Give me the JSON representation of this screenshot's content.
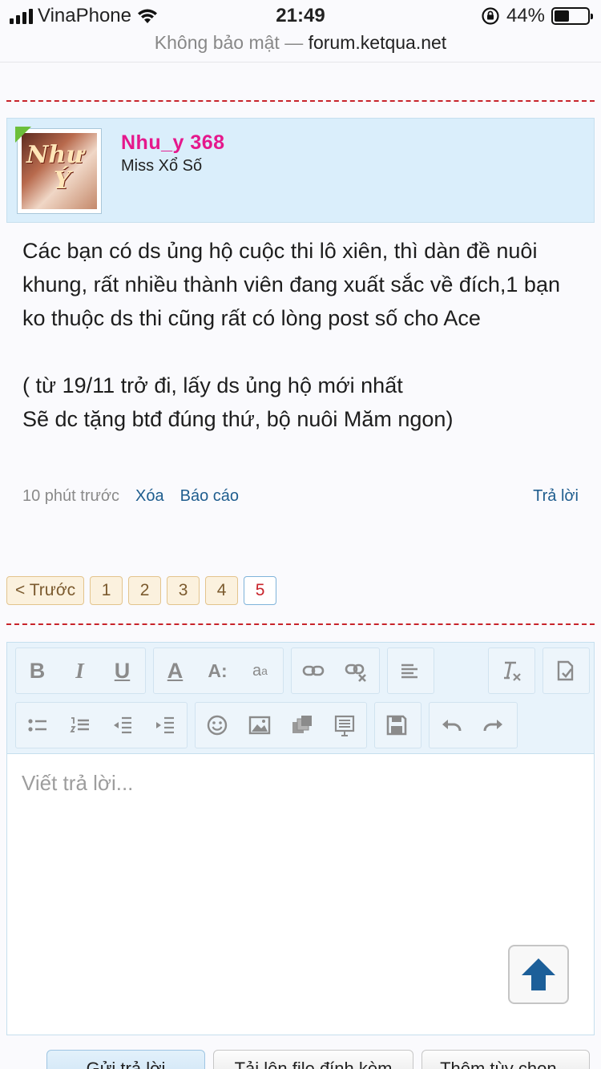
{
  "status_bar": {
    "carrier": "VinaPhone",
    "time": "21:49",
    "battery": "44%",
    "battery_level": 0.44
  },
  "url_bar": {
    "security": "Không bảo mật —",
    "domain": "forum.ketqua.net"
  },
  "post": {
    "author": "Nhu_y 368",
    "author_title": "Miss Xổ Số",
    "avatar_text_1": "Như",
    "avatar_text_2": "Ý",
    "body_1": "Các bạn có ds ủng hộ cuộc thi lô xiên, thì dàn đề nuôi khung, rất nhiều thành viên đang xuất sắc về đích,1 bạn ko thuộc ds thi cũng rất có lòng post số cho Ace",
    "body_2": "( từ 19/11 trở đi, lấy ds ủng hộ mới nhất\nSẽ dc tặng btđ đúng thứ, bộ nuôi Măm ngon)",
    "time": "10 phút trước",
    "delete": "Xóa",
    "report": "Báo cáo",
    "reply": "Trả lời"
  },
  "pagination": {
    "prev": "< Trước",
    "pages": [
      "1",
      "2",
      "3",
      "4",
      "5"
    ],
    "current": "5"
  },
  "editor": {
    "placeholder": "Viết trả lời...",
    "toolbar": {
      "bold": "B",
      "italic": "I",
      "underline": "U",
      "font_color": "A",
      "font_size": "A:",
      "font_family": "a",
      "font_family_sub": "a"
    }
  },
  "buttons": {
    "submit": "Gửi trả lời",
    "upload": "Tải lên file đính kèm",
    "more": "Thêm tùy chọn..."
  }
}
